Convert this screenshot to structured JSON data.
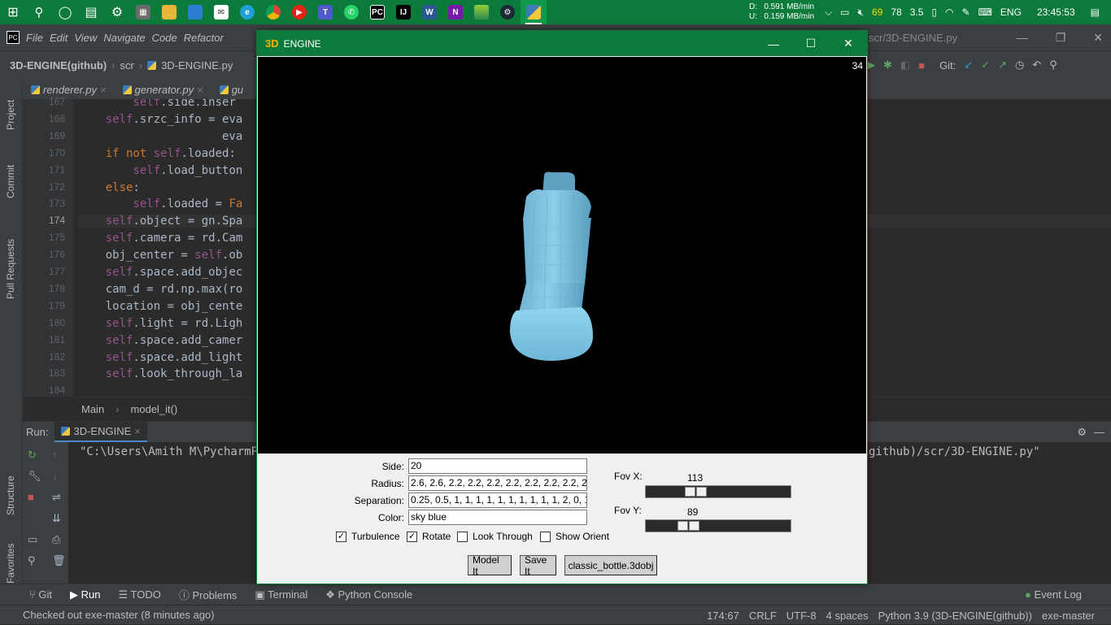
{
  "taskbar": {
    "apps": [
      "start",
      "search",
      "cortana",
      "task-view",
      "settings",
      "calculator",
      "file-explorer",
      "files",
      "mail",
      "edge",
      "chrome",
      "youtube",
      "teams",
      "whatsapp",
      "pycharm",
      "intellij",
      "word",
      "onenote",
      "bluestacks",
      "steam",
      "engine"
    ],
    "net_down": "D:   0.591 MB/min",
    "net_up": "U:   0.159 MB/min",
    "tray_num1": "69",
    "tray_num2": "78",
    "tray_num3": "3.5",
    "language": "ENG",
    "clock": "23:45:53"
  },
  "ide": {
    "menu": [
      "File",
      "Edit",
      "View",
      "Navigate",
      "Code",
      "Refactor"
    ],
    "path_suffix": "scr/3D-ENGINE.py",
    "breadcrumb": [
      "3D-ENGINE(github)",
      "scr",
      "3D-ENGINE.py"
    ],
    "tabs": [
      "renderer.py",
      "generator.py",
      "gu"
    ],
    "side_labels": [
      "Project",
      "Commit",
      "Pull Requests",
      "Structure",
      "Favorites"
    ],
    "git_label": "Git:",
    "code_lines": [
      {
        "num": "167",
        "text": "        self.side.inser"
      },
      {
        "num": "168",
        "text": "    self.srzc_info = eva"
      },
      {
        "num": "169",
        "text": "                     eva"
      },
      {
        "num": "170",
        "text": "    if not self.loaded:"
      },
      {
        "num": "171",
        "text": "        self.load_button"
      },
      {
        "num": "172",
        "text": "    else:"
      },
      {
        "num": "173",
        "text": "        self.loaded = Fa"
      },
      {
        "num": "174",
        "text": "    self.object = gn.Spa"
      },
      {
        "num": "175",
        "text": "    self.camera = rd.Cam"
      },
      {
        "num": "176",
        "text": "    obj_center = self.ob"
      },
      {
        "num": "177",
        "text": "    self.space.add_objec"
      },
      {
        "num": "178",
        "text": "    cam_d = rd.np.max(ro"
      },
      {
        "num": "179",
        "text": "    location = obj_cente"
      },
      {
        "num": "180",
        "text": "    self.light = rd.Ligh"
      },
      {
        "num": "181",
        "text": "    self.space.add_camer"
      },
      {
        "num": "182",
        "text": "    self.space.add_light"
      },
      {
        "num": "183",
        "text": "    self.look_through_la"
      },
      {
        "num": "184",
        "text": ""
      }
    ],
    "code_breadcrumb": [
      "Main",
      "model_it()"
    ],
    "run_label": "Run:",
    "run_tab": "3D-ENGINE",
    "run_cmd_left": "\"C:\\Users\\Amith M\\PycharmPro",
    "run_cmd_right": "github)/scr/3D-ENGINE.py\"",
    "bottom_tools": [
      "Git",
      "Run",
      "TODO",
      "Problems",
      "Terminal",
      "Python Console"
    ],
    "event_log": "Event Log",
    "status_left": "Checked out exe-master (8 minutes ago)",
    "status_right": [
      "174:67",
      "CRLF",
      "UTF-8",
      "4 spaces",
      "Python 3.9 (3D-ENGINE(github))",
      "exe-master"
    ]
  },
  "engine": {
    "title": "ENGINE",
    "logo": "3D",
    "fps": "34",
    "fields": [
      {
        "label": "Side:",
        "value": "20"
      },
      {
        "label": "Radius:",
        "value": "2.6, 2.6, 2.2, 2.2, 2.2, 2.2, 2.2, 2.2, 2.2, 2.2, 2"
      },
      {
        "label": "Separation:",
        "value": "0.25, 0.5, 1, 1, 1, 1, 1, 1, 1, 1, 1, 1, 2, 0, 1"
      },
      {
        "label": "Color:",
        "value": "sky blue"
      }
    ],
    "checks": [
      {
        "label": "Turbulence",
        "checked": true
      },
      {
        "label": "Rotate",
        "checked": true
      },
      {
        "label": "Look Through",
        "checked": false
      },
      {
        "label": "Show Orient",
        "checked": false
      }
    ],
    "fov_x_label": "Fov X:",
    "fov_x_value": "113",
    "fov_y_label": "Fov Y:",
    "fov_y_value": "89",
    "buttons": [
      "Model It",
      "Save It",
      "classic_bottle.3dobj"
    ],
    "object_color": "#87ceeb"
  }
}
